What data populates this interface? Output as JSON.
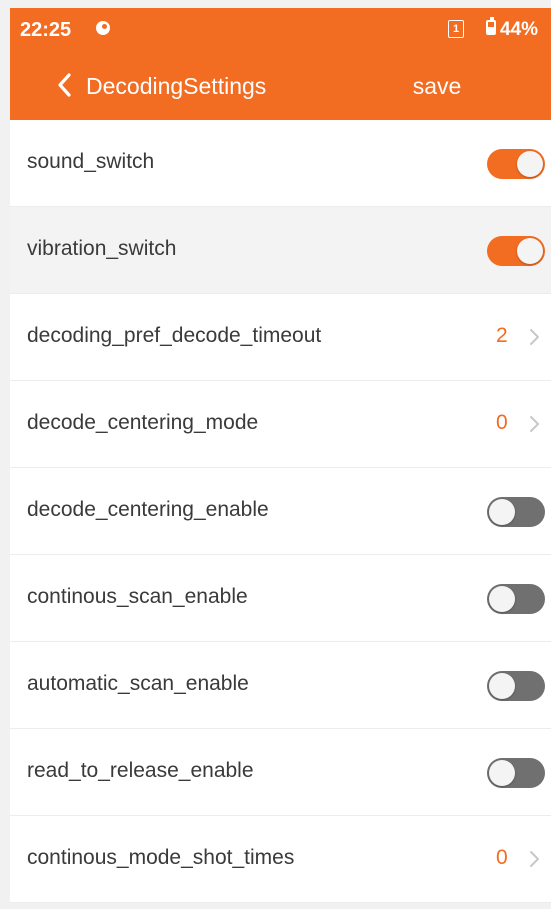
{
  "status_bar": {
    "time": "22:25",
    "sim_slot": "1",
    "battery": "44%"
  },
  "nav": {
    "back_icon": "chevron-left-icon",
    "title": "DecodingSettings",
    "save_label": "save"
  },
  "colors": {
    "accent": "#f26c22",
    "toggle_off": "#707070",
    "row_bg": "#ffffff",
    "row_highlight_bg": "#f3f3f3"
  },
  "settings": [
    {
      "label": "sound_switch",
      "type": "toggle",
      "on": true
    },
    {
      "label": "vibration_switch",
      "type": "toggle",
      "on": true
    },
    {
      "label": "decoding_pref_decode_timeout",
      "type": "value",
      "value": "2"
    },
    {
      "label": "decode_centering_mode",
      "type": "value",
      "value": "0"
    },
    {
      "label": "decode_centering_enable",
      "type": "toggle",
      "on": false
    },
    {
      "label": "continous_scan_enable",
      "type": "toggle",
      "on": false
    },
    {
      "label": "automatic_scan_enable",
      "type": "toggle",
      "on": false
    },
    {
      "label": "read_to_release_enable",
      "type": "toggle",
      "on": false
    },
    {
      "label": "continous_mode_shot_times",
      "type": "value",
      "value": "0"
    }
  ]
}
